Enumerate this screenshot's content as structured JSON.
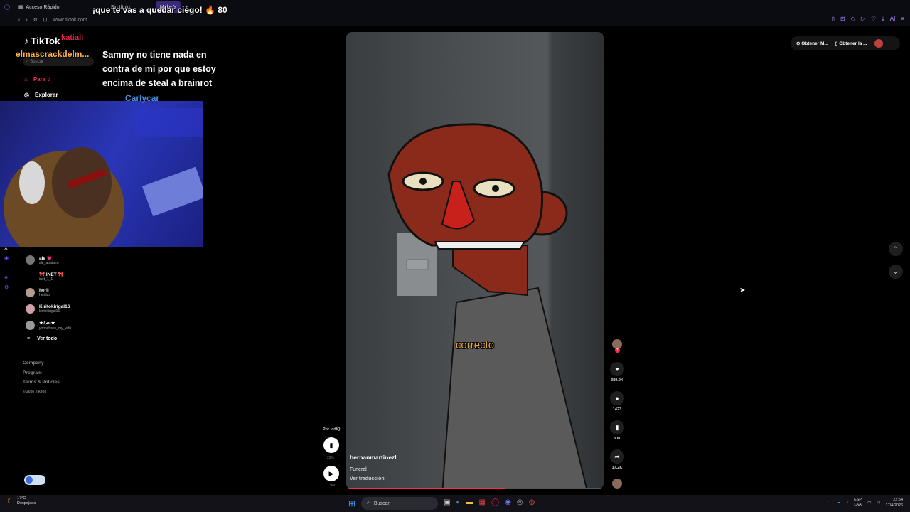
{
  "browser": {
    "tabs": [
      "Acceso Rápido",
      "Sin título",
      "Make Y"
    ],
    "url": "www.tiktok.com",
    "ext_label": "AI"
  },
  "overlay": {
    "top_text": "¡que te vas a quedar ciego! 🔥 80",
    "chat_name_1": "elmascrackdelm...",
    "chat_name_kat": "katiali",
    "chat_message": "Sammy no tiene nada en contra de mi por que estoy encima de steal a brainrot",
    "chat_name_2": "Carlycar"
  },
  "sidebar": {
    "logo": "TikTok",
    "search_placeholder": "Buscar",
    "nav": [
      {
        "label": "Para ti",
        "icon": "home-icon"
      },
      {
        "label": "Explorar",
        "icon": "compass-icon"
      }
    ],
    "following": [
      {
        "name": "ale 💗",
        "handle": "ale_apata.m"
      },
      {
        "name": "🎀 INET 🎀",
        "handle": "inet_1_1"
      },
      {
        "name": "herii",
        "handle": "heriibo"
      },
      {
        "name": "Kiritokirigal16",
        "handle": "kiritokirigal16"
      },
      {
        "name": "★ℒ𝓊𝓈★",
        "handle": "yoonchaes_my_wife"
      }
    ],
    "see_all": "Ver todo",
    "footer": [
      "Company",
      "Program",
      "Terms & Policies"
    ],
    "copyright": "© 2026 TikTok"
  },
  "video": {
    "subtitle": "correcto",
    "author": "hernanmartinezl",
    "description": "Funeral",
    "translate": "Ver traducción",
    "progress": 0.62
  },
  "actions": [
    {
      "icon": "heart-icon",
      "count": "389.9K"
    },
    {
      "icon": "comment-icon",
      "count": "1423"
    },
    {
      "icon": "bookmark-icon",
      "count": "30K"
    },
    {
      "icon": "share-icon",
      "count": "17.2K"
    }
  ],
  "player": {
    "label": "Por vidIQ",
    "percent": "22%",
    "views": "1.9M"
  },
  "right": {
    "get_app_1": "Obtener M...",
    "get_app_2": "Obtener la ..."
  },
  "taskbar": {
    "temp": "17°C",
    "weather": "Despejado",
    "search": "Buscar",
    "lang": "ESP",
    "lang2": "LAA",
    "time": "22:54",
    "date": "17/4/2026"
  }
}
